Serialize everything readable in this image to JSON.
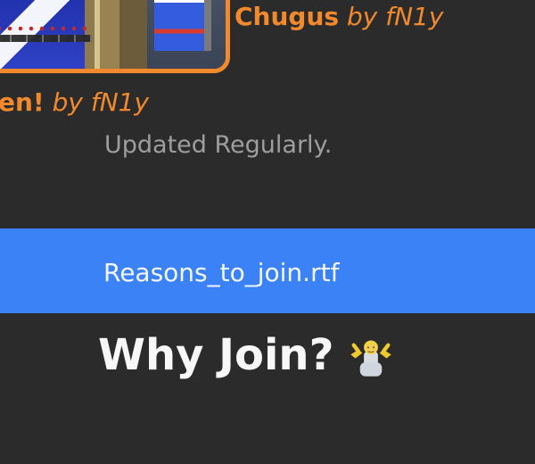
{
  "titles": {
    "first": {
      "name": "Chugus",
      "author": "by fN1y"
    },
    "second": {
      "name": "en!",
      "author": "by fN1y"
    }
  },
  "body": {
    "updated_text": "Updated Regularly.",
    "file_name": "Reasons_to_join.rtf",
    "heading": "Why Join?"
  },
  "icons": {
    "shrug": "person-shrugging-icon"
  },
  "colors": {
    "background": "#2b2b2b",
    "accent_orange": "#f28a2d",
    "file_bar_blue": "#3b82f6",
    "muted_text": "#9e9e9e",
    "heading_text": "#f7f7f7"
  }
}
